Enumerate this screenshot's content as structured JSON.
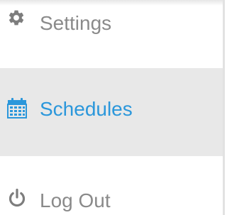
{
  "menu": {
    "items": [
      {
        "label": "Settings",
        "icon": "gear-icon"
      },
      {
        "label": "Schedules",
        "icon": "calendar-icon",
        "active": true
      },
      {
        "label": "Log Out",
        "icon": "power-icon"
      }
    ]
  },
  "colors": {
    "text": "#8a8a8a",
    "active_text": "#2b97db",
    "active_background": "#e8e8e8",
    "icon_gray": "#7d7d7d"
  }
}
